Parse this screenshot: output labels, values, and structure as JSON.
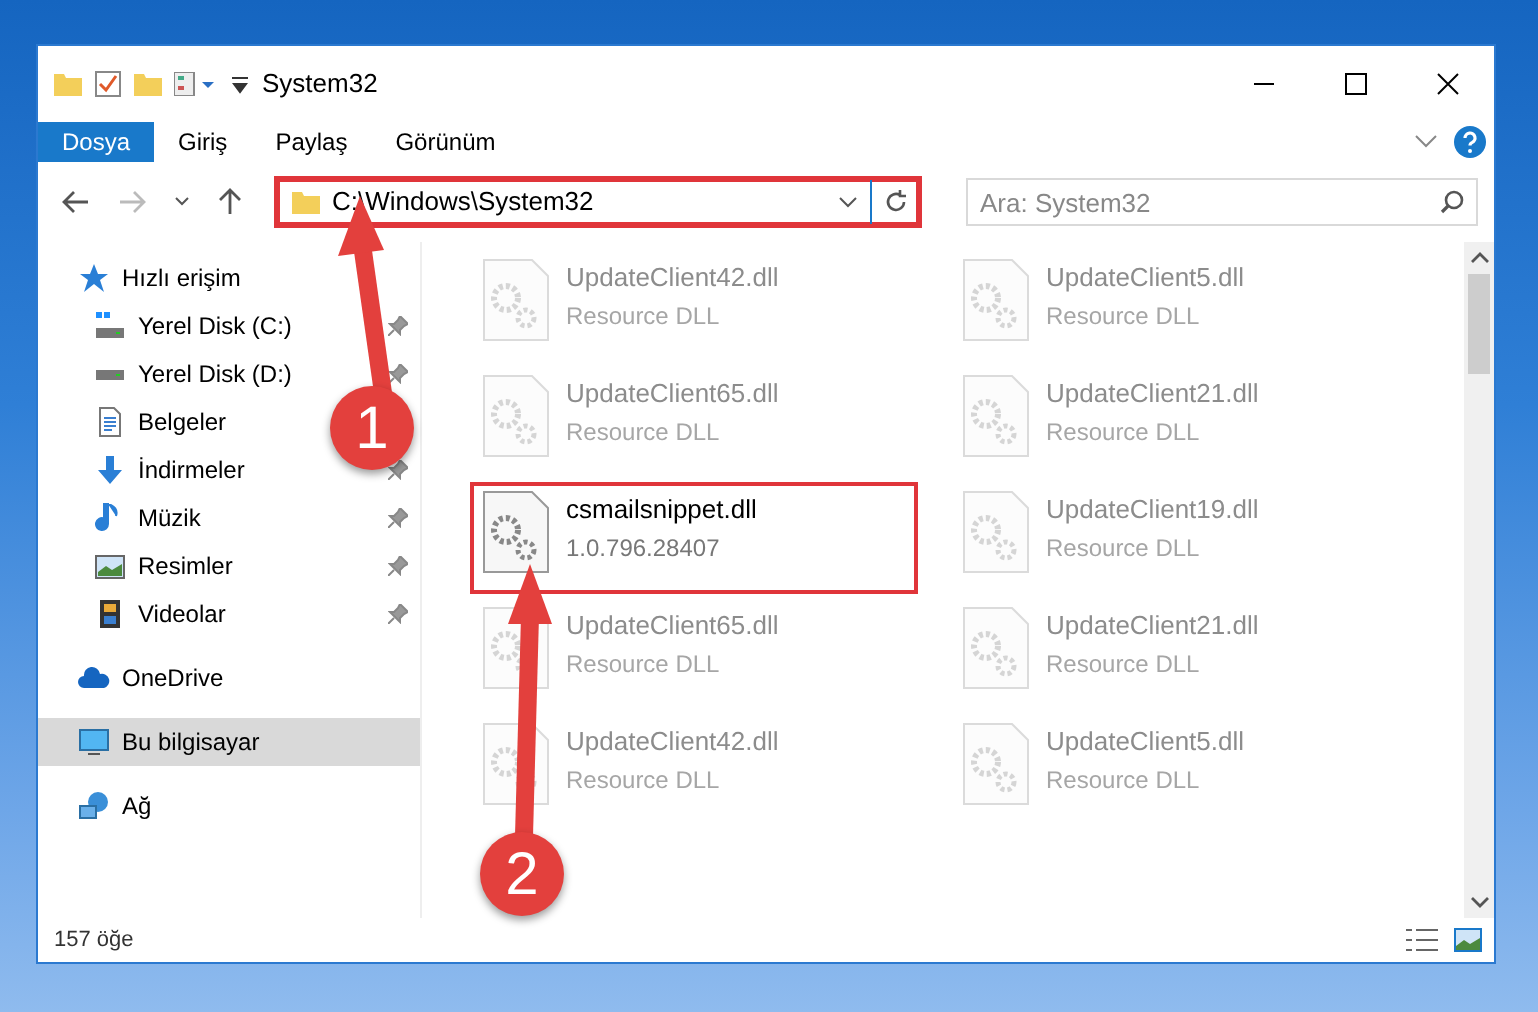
{
  "window": {
    "title": "System32"
  },
  "ribbon_tabs": [
    {
      "label": "Dosya",
      "selected": true
    },
    {
      "label": "Giriş",
      "selected": false
    },
    {
      "label": "Paylaş",
      "selected": false
    },
    {
      "label": "Görünüm",
      "selected": false
    }
  ],
  "address_bar": {
    "path": "C:\\Windows\\System32",
    "highlighted": true
  },
  "search": {
    "placeholder": "Ara: System32"
  },
  "sidebar": {
    "items": [
      {
        "label": "Hızlı erişim",
        "kind": "star",
        "pinned": false,
        "selected": false,
        "children": [
          {
            "label": "Yerel Disk (C:)",
            "kind": "systemdrive",
            "pinned": true,
            "selected": false
          },
          {
            "label": "Yerel Disk (D:)",
            "kind": "drive",
            "pinned": true,
            "selected": false
          },
          {
            "label": "Belgeler",
            "kind": "documents",
            "pinned": false,
            "selected": false
          },
          {
            "label": "İndirmeler",
            "kind": "downloads",
            "pinned": true,
            "selected": false
          },
          {
            "label": "Müzik",
            "kind": "music",
            "pinned": true,
            "selected": false
          },
          {
            "label": "Resimler",
            "kind": "pictures",
            "pinned": true,
            "selected": false
          },
          {
            "label": "Videolar",
            "kind": "videos",
            "pinned": true,
            "selected": false
          }
        ]
      },
      {
        "label": "OneDrive",
        "kind": "cloud",
        "pinned": false,
        "selected": false
      },
      {
        "label": "Bu bilgisayar",
        "kind": "computer",
        "pinned": false,
        "selected": true
      },
      {
        "label": "Ağ",
        "kind": "network",
        "pinned": false,
        "selected": false
      }
    ]
  },
  "files": [
    {
      "name": "UpdateClient42.dll",
      "detail": "Resource DLL",
      "faded": true,
      "highlighted": false
    },
    {
      "name": "UpdateClient5.dll",
      "detail": "Resource DLL",
      "faded": true,
      "highlighted": false
    },
    {
      "name": "UpdateClient65.dll",
      "detail": "Resource DLL",
      "faded": true,
      "highlighted": false
    },
    {
      "name": "UpdateClient21.dll",
      "detail": "Resource DLL",
      "faded": true,
      "highlighted": false
    },
    {
      "name": "csmailsnippet.dll",
      "detail": "1.0.796.28407",
      "faded": false,
      "highlighted": true
    },
    {
      "name": "UpdateClient19.dll",
      "detail": "Resource DLL",
      "faded": true,
      "highlighted": false
    },
    {
      "name": "UpdateClient65.dll",
      "detail": "Resource DLL",
      "faded": true,
      "highlighted": false
    },
    {
      "name": "UpdateClient21.dll",
      "detail": "Resource DLL",
      "faded": true,
      "highlighted": false
    },
    {
      "name": "UpdateClient42.dll",
      "detail": "Resource DLL",
      "faded": true,
      "highlighted": false
    },
    {
      "name": "UpdateClient5.dll",
      "detail": "Resource DLL",
      "faded": true,
      "highlighted": false
    }
  ],
  "status_bar": {
    "count": "157 öğe"
  },
  "annotations": [
    {
      "label": "1"
    },
    {
      "label": "2"
    }
  ]
}
